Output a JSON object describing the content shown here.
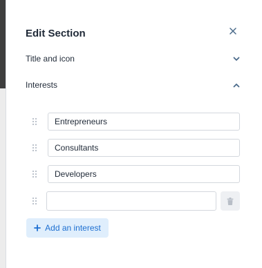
{
  "panel": {
    "title": "Edit Section"
  },
  "sections": {
    "title_and_icon": {
      "label": "Title and icon",
      "state": "collapsed"
    },
    "interests": {
      "label": "Interests",
      "state": "expanded"
    }
  },
  "interests": {
    "items": [
      {
        "value": "Entrepreneurs"
      },
      {
        "value": "Consultants"
      },
      {
        "value": "Developers"
      },
      {
        "value": ""
      }
    ],
    "add_label": "Add an interest"
  },
  "icons": {
    "close": "close-icon",
    "chevron_down": "chevron-down-icon",
    "chevron_up": "chevron-up-icon",
    "drag": "drag-handle-icon",
    "trash": "trash-icon",
    "plus": "plus-icon"
  },
  "colors": {
    "accent": "#1d6fd1",
    "accent_bg": "#dfeefc",
    "chevron": "#4a6a8a",
    "text": "#1f2937"
  }
}
